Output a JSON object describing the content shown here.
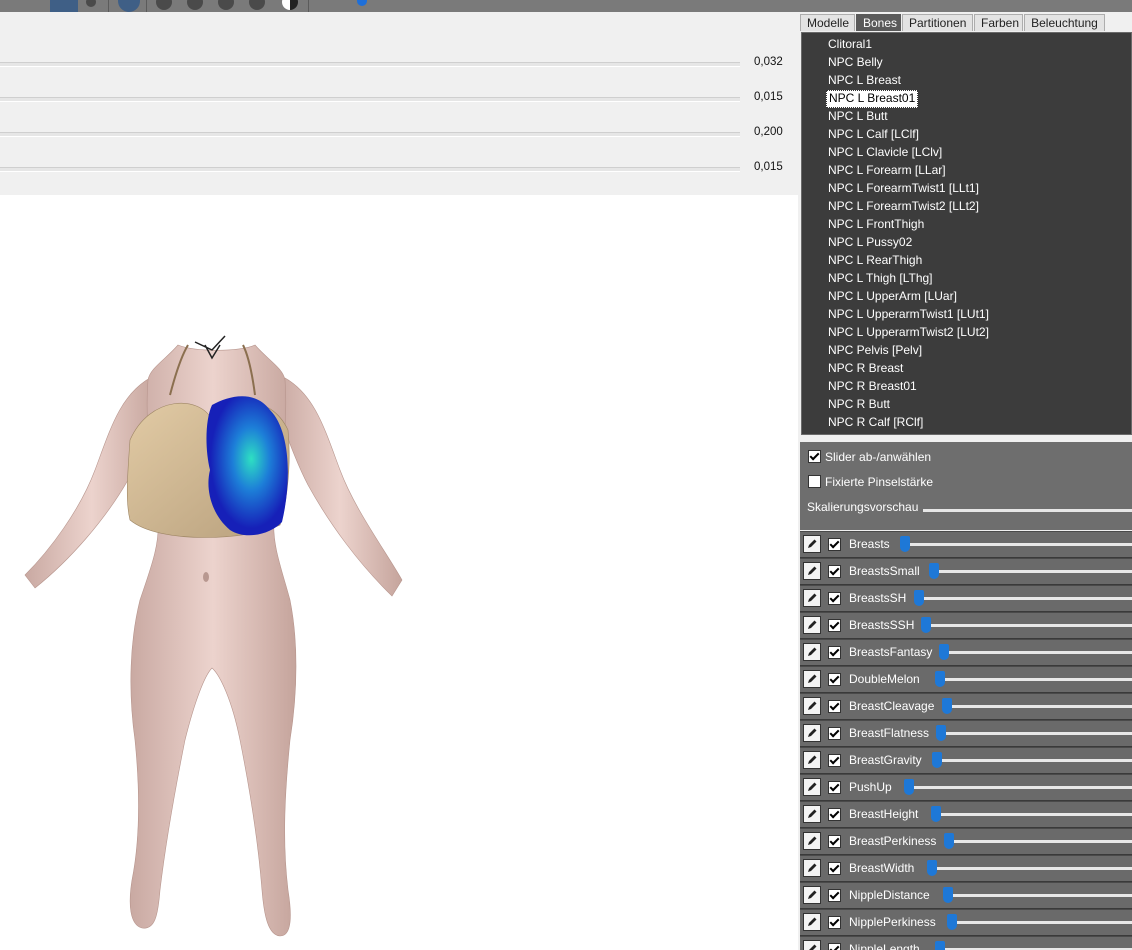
{
  "params": {
    "values": [
      "0,032",
      "0,015",
      "0,200",
      "0,015"
    ]
  },
  "tabs": [
    {
      "label": "Modelle",
      "active": false
    },
    {
      "label": "Bones",
      "active": true
    },
    {
      "label": "Partitionen",
      "active": false
    },
    {
      "label": "Farben",
      "active": false
    },
    {
      "label": "Beleuchtung",
      "active": false
    }
  ],
  "bones": [
    "Clitoral1",
    "NPC Belly",
    "NPC L Breast",
    "NPC L Breast01",
    "NPC L Butt",
    "NPC L Calf [LClf]",
    "NPC L Clavicle [LClv]",
    "NPC L Forearm [LLar]",
    "NPC L ForearmTwist1 [LLt1]",
    "NPC L ForearmTwist2 [LLt2]",
    "NPC L FrontThigh",
    "NPC L Pussy02",
    "NPC L RearThigh",
    "NPC L Thigh [LThg]",
    "NPC L UpperArm [LUar]",
    "NPC L UpperarmTwist1 [LUt1]",
    "NPC L UpperarmTwist2 [LUt2]",
    "NPC Pelvis [Pelv]",
    "NPC R Breast",
    "NPC R Breast01",
    "NPC R Butt",
    "NPC R Calf [RClf]"
  ],
  "selected_bone": "NPC L Breast01",
  "options": {
    "slider_toggle": {
      "label": "Slider ab-/anwählen",
      "checked": true
    },
    "fixed_brush": {
      "label": "Fixierte Pinselstärke",
      "checked": false
    },
    "scale_preview": {
      "label": "Skalierungsvorschau"
    }
  },
  "sliders": [
    {
      "name": "Breasts",
      "checked": true
    },
    {
      "name": "BreastsSmall",
      "checked": true
    },
    {
      "name": "BreastsSH",
      "checked": true
    },
    {
      "name": "BreastsSSH",
      "checked": true
    },
    {
      "name": "BreastsFantasy",
      "checked": true
    },
    {
      "name": "DoubleMelon",
      "checked": true
    },
    {
      "name": "BreastCleavage",
      "checked": true
    },
    {
      "name": "BreastFlatness",
      "checked": true
    },
    {
      "name": "BreastGravity",
      "checked": true
    },
    {
      "name": "PushUp",
      "checked": true
    },
    {
      "name": "BreastHeight",
      "checked": true
    },
    {
      "name": "BreastPerkiness",
      "checked": true
    },
    {
      "name": "BreastWidth",
      "checked": true
    },
    {
      "name": "NippleDistance",
      "checked": true
    },
    {
      "name": "NipplePerkiness",
      "checked": true
    },
    {
      "name": "NippleLength",
      "checked": true
    }
  ],
  "icons": {
    "pen": "pencil-icon",
    "checkbox": "checkbox-icon"
  }
}
